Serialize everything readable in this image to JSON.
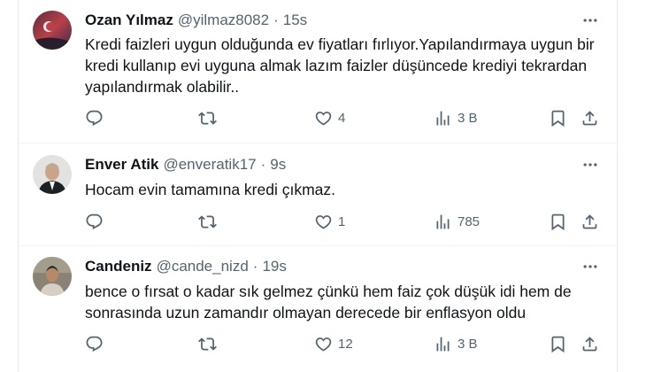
{
  "tweets": [
    {
      "name": "Ozan Yılmaz",
      "handle": "@yilmaz8082",
      "dot": "·",
      "time": "15s",
      "text": "Kredi faizleri uygun olduğunda ev fiyatları fırlıyor.Yapılandırmaya uygun bir\nkredi kullanıp evi uyguna almak lazım faizler düşüncede krediyi tekrardan\nyapılandırmak olabilir..",
      "likes": "4",
      "views": "3 B"
    },
    {
      "name": "Enver Atik",
      "handle": "@enveratik17",
      "dot": "·",
      "time": "9s",
      "text": "Hocam evin tamamına kredi çıkmaz.",
      "likes": "1",
      "views": "785"
    },
    {
      "name": "Candeniz",
      "handle": "@cande_nizd",
      "dot": "·",
      "time": "19s",
      "text": "bence o fırsat o kadar sık gelmez çünkü hem faiz çok düşük idi hem de\nsonrasında uzun zamandır olmayan derecede bir enflasyon oldu",
      "likes": "12",
      "views": "3 B"
    }
  ],
  "icons": {
    "more": "more-horizontal-icon",
    "reply": "reply-icon",
    "retweet": "retweet-icon",
    "like": "heart-icon",
    "views": "views-icon",
    "bookmark": "bookmark-icon",
    "share": "share-icon"
  },
  "colors": {
    "text_primary": "#0f1419",
    "text_secondary": "#536471",
    "divider": "#eff3f4"
  }
}
